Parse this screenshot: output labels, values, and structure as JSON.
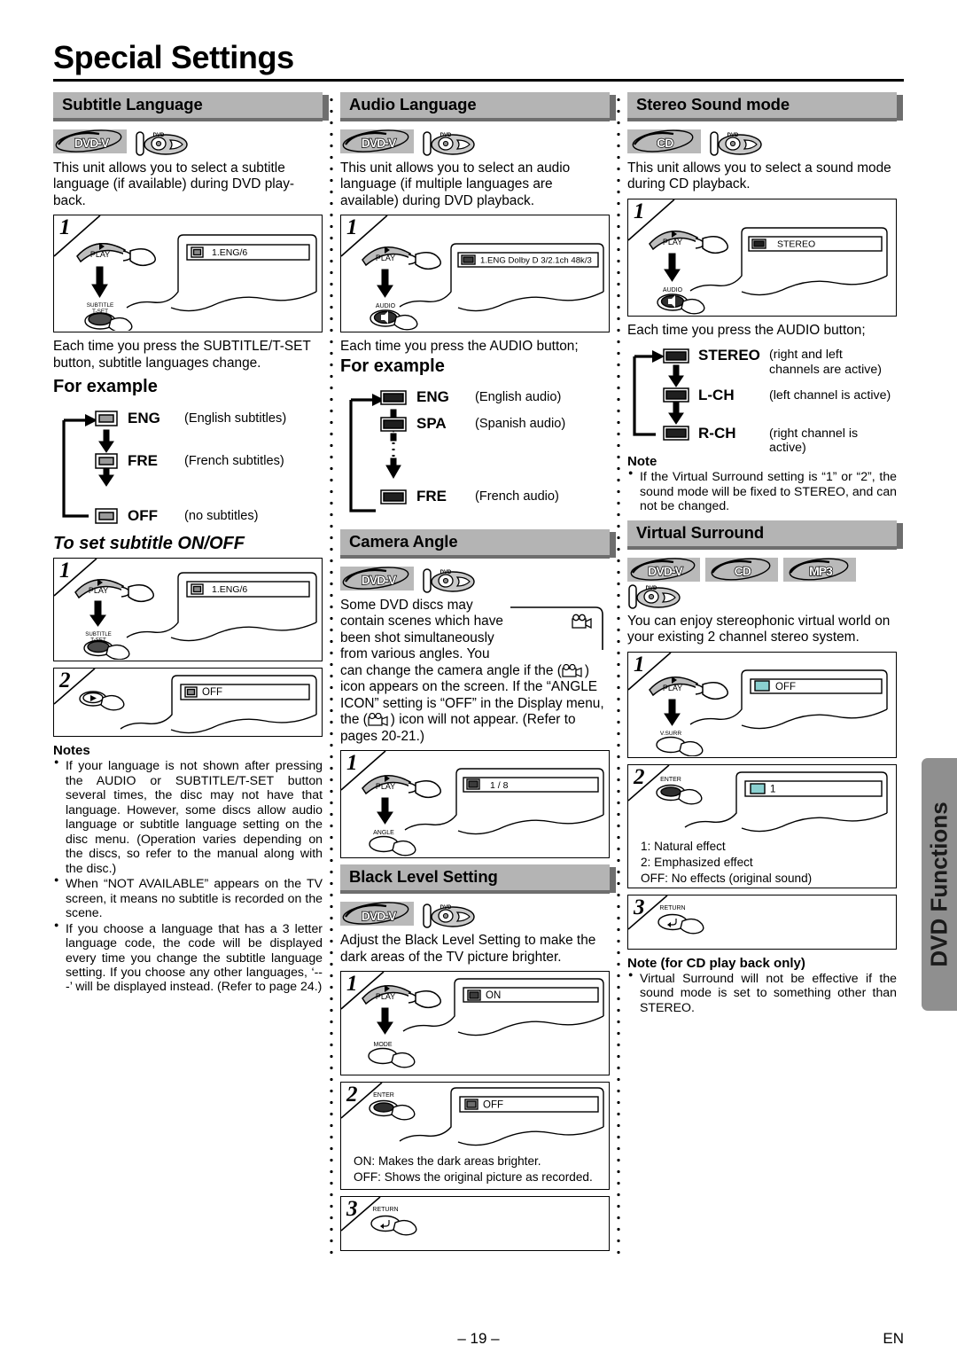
{
  "page": {
    "title": "Special Settings",
    "side_tab": "DVD Functions",
    "page_number": "– 19 –",
    "language_code": "EN"
  },
  "subtitle_language": {
    "heading": "Subtitle Language",
    "badges": [
      "DVD-V"
    ],
    "disc_icon": "disc-in-tray-icon",
    "intro": "This unit allows you to select a subtitle language (if available) during DVD play-back.",
    "step1": {
      "number": "1",
      "button_top": "PLAY",
      "button_bottom": "SUBTITLE\nT-SET",
      "osd_text": "1.ENG/6",
      "osd_icon": "subtitle-icon"
    },
    "after_text": "Each time you press the SUBTITLE/T-SET button, subtitle languages change.",
    "for_example_label": "For example",
    "cycle": [
      {
        "icon": "subtitle-icon",
        "name": "ENG",
        "desc": "(English subtitles)"
      },
      {
        "icon": "subtitle-icon",
        "name": "FRE",
        "desc": "(French subtitles)"
      },
      {
        "icon": "subtitle-icon",
        "name": "OFF",
        "desc": "(no subtitles)"
      }
    ],
    "onoff_heading": "To set subtitle ON/OFF",
    "onoff_step1": {
      "number": "1",
      "button_top": "PLAY",
      "button_bottom": "SUBTITLE\nT-SET",
      "osd_text": "1.ENG/6"
    },
    "onoff_step2": {
      "number": "2",
      "osd_text": "OFF"
    },
    "notes_title": "Notes",
    "notes": [
      "If your language is not shown after pressing the AUDIO or SUBTITLE/T-SET button several times, the disc may not have that language. However, some discs allow audio language or subtitle language setting on the disc menu. (Operation varies depending on the discs, so refer to the manual along with the disc.)",
      "When “NOT AVAILABLE” appears on the TV screen, it means no subtitle is recorded on the scene.",
      "If you choose a language that has a 3 letter language code, the code will be displayed every time you change the subtitle language setting. If you choose any other languages, ‘---’ will be displayed instead. (Refer to page 24.)"
    ]
  },
  "audio_language": {
    "heading": "Audio Language",
    "badges": [
      "DVD-V"
    ],
    "intro": "This unit allows you to select an audio language (if multiple languages are available) during DVD playback.",
    "step1": {
      "number": "1",
      "button_top": "PLAY",
      "button_bottom": "AUDIO",
      "osd_text": "1.ENG  Dolby D  3/2.1ch  48k/3",
      "osd_icon": "audio-icon"
    },
    "after_text": "Each time you press the AUDIO button;",
    "for_example_label": "For example",
    "cycle": [
      {
        "icon": "audio-icon",
        "name": "ENG",
        "desc": "(English audio)"
      },
      {
        "icon": "audio-icon",
        "name": "SPA",
        "desc": "(Spanish audio)"
      },
      {
        "icon": "audio-icon",
        "name": "FRE",
        "desc": "(French audio)"
      }
    ]
  },
  "camera_angle": {
    "heading": "Camera Angle",
    "badges": [
      "DVD-V"
    ],
    "intro_part1": "Some DVD discs may contain scenes which have been shot simultaneously from various angles. You can change the camera angle if the (",
    "intro_part2": ") icon appears on the screen. If the “ANGLE ICON” setting is “OFF” in the Display menu, the (",
    "intro_part3": ") icon will not appear. (Refer to pages 20-21.)",
    "step1": {
      "number": "1",
      "button_top": "PLAY",
      "button_bottom": "ANGLE",
      "osd_text": "1 / 8",
      "osd_icon": "angle-icon"
    }
  },
  "black_level": {
    "heading": "Black Level Setting",
    "badges": [
      "DVD-V"
    ],
    "intro": "Adjust the Black Level Setting to make the dark areas of the TV picture brighter.",
    "step1": {
      "number": "1",
      "button_top": "PLAY",
      "button_bottom": "MODE",
      "osd_text": "ON",
      "osd_icon": "picture-icon"
    },
    "step2": {
      "number": "2",
      "button_top": "ENTER",
      "osd_text": "OFF",
      "osd_icon": "picture-icon",
      "legend": [
        "ON: Makes the dark areas brighter.",
        "OFF: Shows the original picture as recorded."
      ]
    },
    "step3": {
      "number": "3",
      "button_top": "RETURN"
    }
  },
  "stereo_sound": {
    "heading": "Stereo Sound mode",
    "badges": [
      "CD"
    ],
    "intro": "This unit allows you to select a sound mode during CD playback.",
    "step1": {
      "number": "1",
      "button_top": "PLAY",
      "button_bottom": "AUDIO",
      "osd_text": "STEREO",
      "osd_icon": "audio-icon"
    },
    "after_text": "Each time you press the AUDIO button;",
    "cycle": [
      {
        "icon": "audio-icon",
        "name": "STEREO",
        "desc": "(right and left channels are active)"
      },
      {
        "icon": "audio-icon",
        "name": "L-CH",
        "desc": "(left channel is active)"
      },
      {
        "icon": "audio-icon",
        "name": "R-CH",
        "desc": "(right channel is active)"
      }
    ],
    "note_title": "Note",
    "notes": [
      "If the Virtual Surround setting is “1” or “2”, the sound mode will be fixed to STEREO, and can not be changed."
    ]
  },
  "virtual_surround": {
    "heading": "Virtual Surround",
    "badges": [
      "DVD-V",
      "CD",
      "MP3"
    ],
    "intro": "You can enjoy stereophonic virtual world on your existing 2 channel stereo system.",
    "step1": {
      "number": "1",
      "button_top": "PLAY",
      "button_bottom": "V.SURR",
      "osd_text": "OFF",
      "osd_icon": "vsurround-icon"
    },
    "step2": {
      "number": "2",
      "button_top": "ENTER",
      "osd_text": "1",
      "osd_icon": "vsurround-icon",
      "legend": [
        "1: Natural effect",
        "2: Emphasized effect",
        "OFF: No effects (original sound)"
      ]
    },
    "step3": {
      "number": "3",
      "button_top": "RETURN"
    },
    "note_title": "Note (for CD play back only)",
    "notes": [
      "Virtual Surround will not be effective if the sound mode is set to something other than STEREO."
    ]
  }
}
